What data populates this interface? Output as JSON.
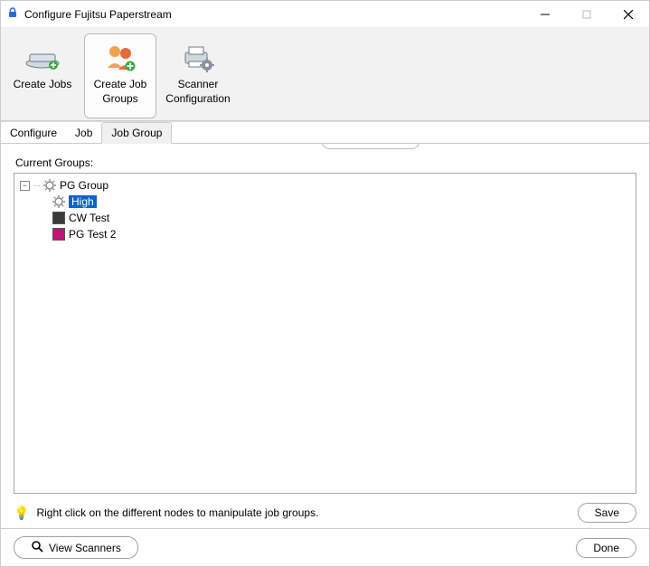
{
  "window": {
    "title": "Configure Fujitsu Paperstream"
  },
  "toolbar": {
    "create_jobs": "Create Jobs",
    "create_job_groups_line1": "Create Job",
    "create_job_groups_line2": "Groups",
    "scanner_config_line1": "Scanner",
    "scanner_config_line2": "Configuration"
  },
  "tabs": {
    "configure": "Configure",
    "job": "Job",
    "job_group": "Job Group"
  },
  "main": {
    "current_groups_label": "Current Groups:"
  },
  "tree": {
    "root": "PG Group",
    "items": [
      {
        "label": "High",
        "color": "gear",
        "selected": true
      },
      {
        "label": "CW Test",
        "color": "#3a3a3a",
        "selected": false
      },
      {
        "label": "PG Test 2",
        "color": "#c41376",
        "selected": false
      }
    ]
  },
  "hint": {
    "text": "Right click on the different nodes to manipulate job groups."
  },
  "buttons": {
    "save": "Save",
    "view_scanners": "View Scanners",
    "done": "Done"
  }
}
